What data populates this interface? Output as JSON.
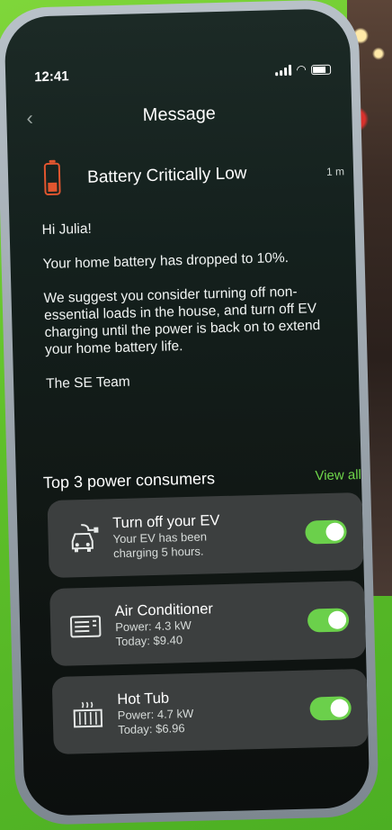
{
  "status_bar": {
    "time": "12:41"
  },
  "nav": {
    "back_glyph": "‹",
    "title": "Message"
  },
  "message": {
    "title": "Battery Critically Low",
    "time": "1 m",
    "greeting": "Hi Julia!",
    "line1": "Your home battery has dropped to 10%.",
    "line2": "We suggest you consider turning off non-essential loads in the house, and turn off EV charging until the power is back on to extend your home battery life.",
    "signature": "The SE Team",
    "icon": "battery-low-icon",
    "icon_color": "#e2562f"
  },
  "consumers": {
    "title": "Top 3 power consumers",
    "view_all": "View all",
    "accent": "#6bd04b",
    "items": [
      {
        "icon": "ev-car-icon",
        "title": "Turn off your EV",
        "line1": "Your EV has been",
        "line2": "charging 5 hours.",
        "enabled": true
      },
      {
        "icon": "air-conditioner-icon",
        "title": "Air Conditioner",
        "line1": "Power: 4.3 kW",
        "line2": "Today: $9.40",
        "enabled": true
      },
      {
        "icon": "hot-tub-icon",
        "title": "Hot Tub",
        "line1": "Power: 4.7 kW",
        "line2": "Today: $6.96",
        "enabled": true
      }
    ]
  }
}
